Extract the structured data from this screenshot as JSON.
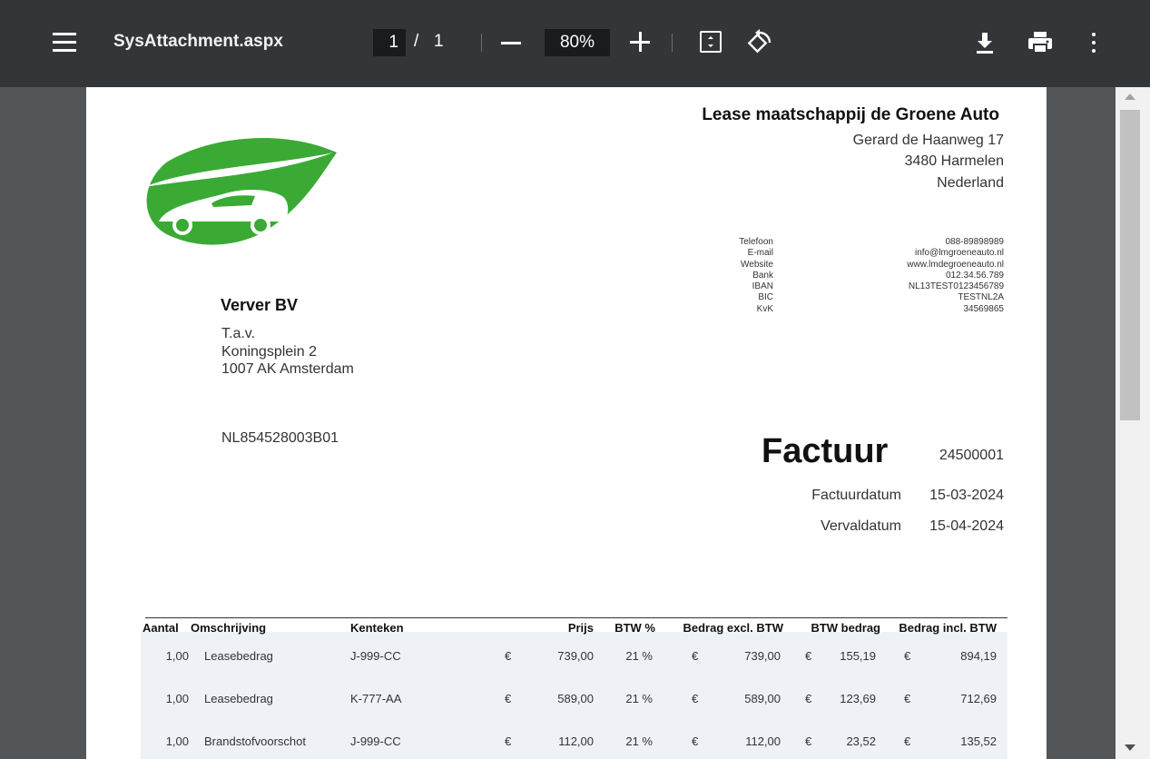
{
  "toolbar": {
    "title": "SysAttachment.aspx",
    "page_current": "1",
    "page_separator": "/",
    "page_total": "1",
    "zoom": "80%"
  },
  "company": {
    "name": "Lease maatschappij de Groene Auto",
    "street": "Gerard de Haanweg 17",
    "city": "3480  Harmelen",
    "country": "Nederland",
    "brand_color": "#3aaa35"
  },
  "contact": {
    "labels": [
      "Telefoon",
      "E-mail",
      "Website",
      "Bank",
      "IBAN",
      "BIC",
      "KvK"
    ],
    "values": [
      "088-89898989",
      "info@lmgroeneauto.nl",
      "www.lmdegroeneauto.nl",
      "012.34.56.789",
      "NL13TEST0123456789",
      "TESTNL2A",
      "34569865"
    ]
  },
  "customer": {
    "name": "Verver BV",
    "attn": "T.a.v.",
    "street": "Koningsplein 2",
    "city": "1007 AK  Amsterdam",
    "vat": "NL854528003B01"
  },
  "invoice": {
    "title": "Factuur",
    "number": "24500001",
    "date_label": "Factuurdatum",
    "date": "15-03-2024",
    "due_label": "Vervaldatum",
    "due_date": "15-04-2024"
  },
  "table": {
    "headers": {
      "qty": "Aantal",
      "desc": "Omschrijving",
      "plate": "Kenteken",
      "price": "Prijs",
      "vat_pct": "BTW %",
      "excl": "Bedrag excl. BTW",
      "vat_amt": "BTW bedrag",
      "incl": "Bedrag incl. BTW"
    },
    "currency": "€",
    "rows": [
      {
        "qty": "1,00",
        "desc": "Leasebedrag",
        "plate": "J-999-CC",
        "price": "739,00",
        "vat_pct": "21 %",
        "excl": "739,00",
        "vat_amt": "155,19",
        "incl": "894,19"
      },
      {
        "qty": "1,00",
        "desc": "Leasebedrag",
        "plate": "K-777-AA",
        "price": "589,00",
        "vat_pct": "21 %",
        "excl": "589,00",
        "vat_amt": "123,69",
        "incl": "712,69"
      },
      {
        "qty": "1,00",
        "desc": "Brandstofvoorschot",
        "plate": "J-999-CC",
        "price": "112,00",
        "vat_pct": "21 %",
        "excl": "112,00",
        "vat_amt": "23,52",
        "incl": "135,52"
      }
    ]
  }
}
